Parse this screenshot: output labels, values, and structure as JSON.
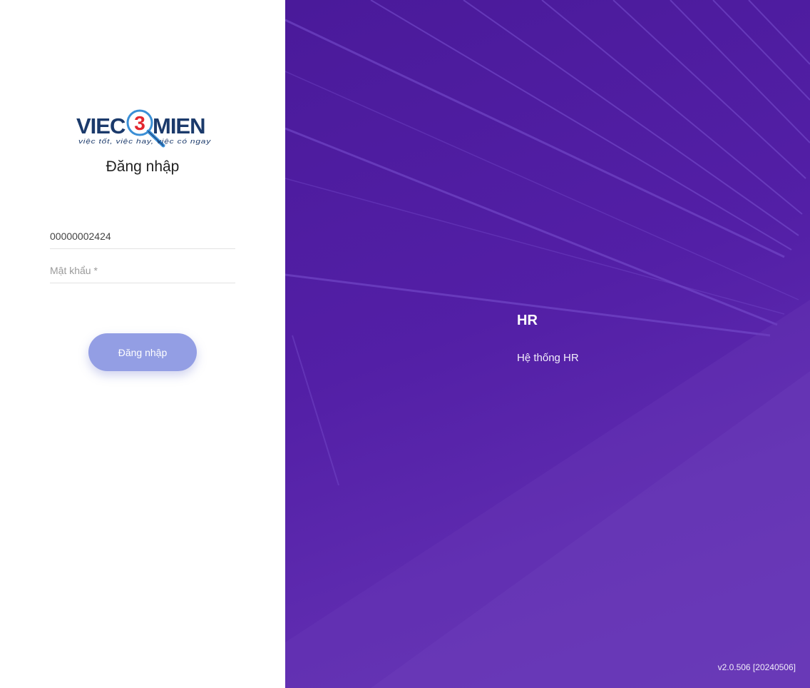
{
  "logo": {
    "part1": "VIEC",
    "number": "3",
    "part2": "MIEN",
    "tagline": "việc tốt, việc hay, việc có ngay",
    "colors": {
      "navy": "#1b3a6b",
      "red": "#e3262e",
      "blue": "#3a8fd6"
    }
  },
  "login": {
    "title": "Đăng nhập",
    "username_value": "00000002424",
    "password_placeholder": "Mật khẩu *",
    "submit_label": "Đăng nhập"
  },
  "hero": {
    "title": "HR",
    "subtitle": "Hệ thống HR",
    "version": "v2.0.506 [20240506]"
  },
  "colors": {
    "hero_purple": "#531fa6",
    "button": "#939ee4"
  }
}
